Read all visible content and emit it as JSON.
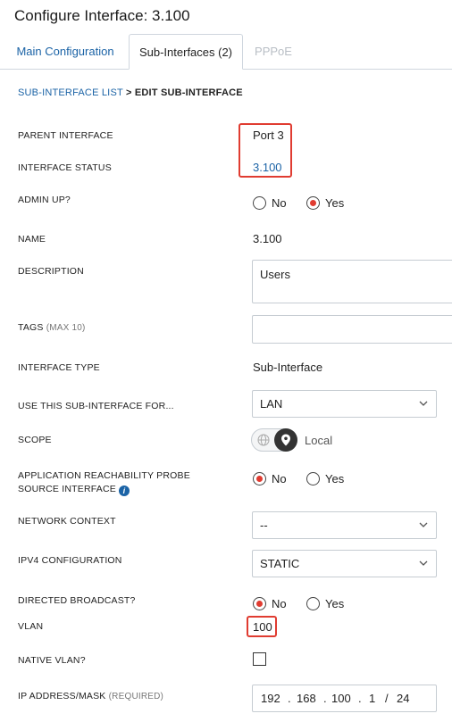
{
  "title": "Configure Interface: 3.100",
  "tabs": [
    {
      "label": "Main Configuration",
      "state": "inactive"
    },
    {
      "label": "Sub-Interfaces (2)",
      "state": "active"
    },
    {
      "label": "PPPoE",
      "state": "disabled"
    }
  ],
  "breadcrumb": {
    "link": "SUB-INTERFACE LIST",
    "separator": ">",
    "current": "EDIT SUB-INTERFACE"
  },
  "fields": {
    "parent_interface": {
      "label": "PARENT INTERFACE",
      "value": "Port 3"
    },
    "interface_status": {
      "label": "INTERFACE STATUS",
      "value": "3.100"
    },
    "admin_up": {
      "label": "ADMIN UP?",
      "options": [
        "No",
        "Yes"
      ],
      "selected": "Yes"
    },
    "name": {
      "label": "NAME",
      "value": "3.100"
    },
    "description": {
      "label": "DESCRIPTION",
      "value": "Users"
    },
    "tags": {
      "label": "TAGS",
      "hint": "(MAX 10)",
      "value": ""
    },
    "interface_type": {
      "label": "INTERFACE TYPE",
      "value": "Sub-Interface"
    },
    "use_for": {
      "label": "USE THIS SUB-INTERFACE FOR...",
      "value": "LAN"
    },
    "scope": {
      "label": "SCOPE",
      "value": "Local"
    },
    "app_probe": {
      "label_line1": "APPLICATION REACHABILITY PROBE",
      "label_line2": "SOURCE INTERFACE",
      "options": [
        "No",
        "Yes"
      ],
      "selected": "No"
    },
    "network_context": {
      "label": "NETWORK CONTEXT",
      "value": "--"
    },
    "ipv4_config": {
      "label": "IPV4 CONFIGURATION",
      "value": "STATIC"
    },
    "directed_broadcast": {
      "label": "DIRECTED BROADCAST?",
      "options": [
        "No",
        "Yes"
      ],
      "selected": "No"
    },
    "vlan": {
      "label": "VLAN",
      "value": "100"
    },
    "native_vlan": {
      "label": "NATIVE VLAN?",
      "checked": false
    },
    "ip_address": {
      "label": "IP ADDRESS/MASK",
      "hint": "(REQUIRED)",
      "octets": [
        "192",
        "168",
        "100",
        "1"
      ],
      "dot": ".",
      "slash": "/",
      "mask": "24"
    }
  },
  "colors": {
    "accent": "#1b63a6",
    "highlight": "#e03c31",
    "border": "#c6ccd2"
  }
}
